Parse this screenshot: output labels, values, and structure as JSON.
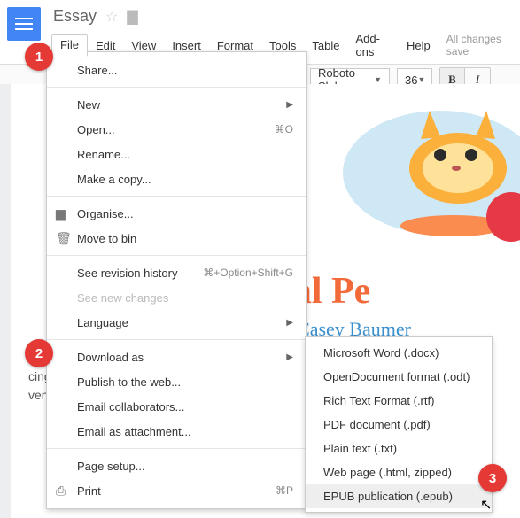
{
  "doc": {
    "title": "Essay"
  },
  "menubar": {
    "file": "File",
    "edit": "Edit",
    "view": "View",
    "insert": "Insert",
    "format": "Format",
    "tools": "Tools",
    "table": "Table",
    "addons": "Add-ons",
    "help": "Help",
    "save_status": "All changes save"
  },
  "toolbar": {
    "font": "Roboto Slab",
    "font_size": "36"
  },
  "file_menu": {
    "share": "Share...",
    "new": "New",
    "open": "Open...",
    "open_shortcut": "⌘O",
    "rename": "Rename...",
    "make_copy": "Make a copy...",
    "organise": "Organise...",
    "move_to_bin": "Move to bin",
    "revision": "See revision history",
    "revision_shortcut": "⌘+Option+Shift+G",
    "see_new": "See new changes",
    "language": "Language",
    "download_as": "Download as",
    "publish": "Publish to the web...",
    "email_collab": "Email collaborators...",
    "email_attach": "Email as attachment...",
    "page_setup": "Page setup...",
    "print": "Print",
    "print_shortcut": "⌘P"
  },
  "download_submenu": {
    "docx": "Microsoft Word (.docx)",
    "odt": "OpenDocument format (.odt)",
    "rtf": "Rich Text Format (.rtf)",
    "pdf": "PDF document (.pdf)",
    "txt": "Plain text (.txt)",
    "html": "Web page (.html, zipped)",
    "epub": "EPUB publication (.epub)"
  },
  "document": {
    "title": "The Ideal Pe",
    "subtitle": "Casey Baumer",
    "body": "cing nati|aliquet nec, vulputate eget, arcu. In enim justo, rhoncus ut, imperdiet a, venenatis vitae, justo. Nullam dictum felis eu pede mollis pretium. Integer ti"
  },
  "badges": {
    "b1": "1",
    "b2": "2",
    "b3": "3"
  }
}
